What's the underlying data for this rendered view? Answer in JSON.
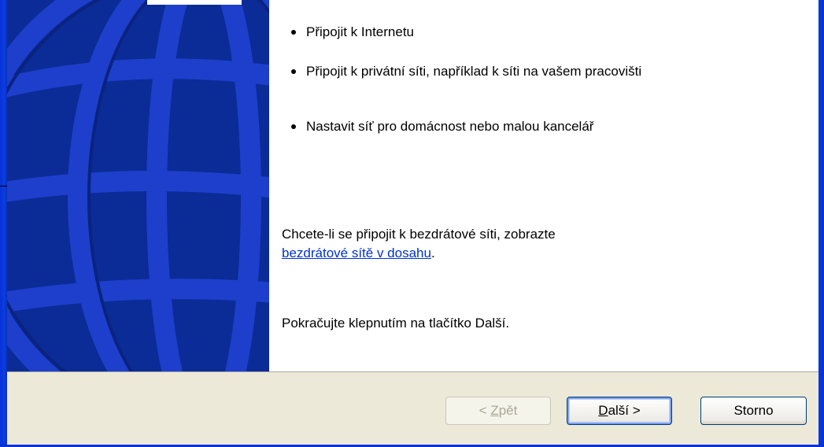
{
  "window": {
    "bullets": [
      "Připojit k Internetu",
      "Připojit k privátní síti, například k síti na vašem pracovišti",
      "Nastavit síť pro domácnost nebo malou kancelář"
    ],
    "wireless_prefix": "Chcete-li se připojit k bezdrátové síti, zobrazte",
    "wireless_link": "bezdrátové sítě v dosahu",
    "wireless_suffix": ".",
    "continue_text": "Pokračujte klepnutím na tlačítko Další."
  },
  "buttons": {
    "back": {
      "mnemonic": "Z",
      "rest": "pět",
      "prefix": "< ",
      "enabled": false
    },
    "next": {
      "mnemonic": "D",
      "rest": "alší >",
      "enabled": true,
      "focused": true
    },
    "cancel": {
      "label": "Storno",
      "enabled": true
    }
  },
  "colors": {
    "frame_blue": "#0831d9",
    "banner_blue": "#0a2a8f",
    "globe_blue": "#1940c9",
    "link_blue": "#0033cc",
    "button_bar": "#ece9d8"
  },
  "icons": {
    "banner": "globe-graphic"
  }
}
